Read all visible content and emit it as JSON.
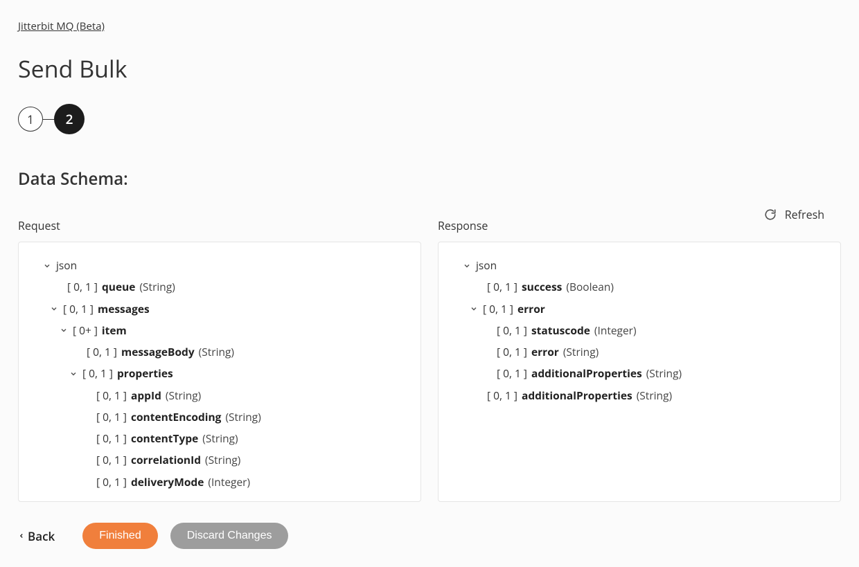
{
  "breadcrumb": "Jitterbit MQ (Beta)",
  "page_title": "Send Bulk",
  "stepper": {
    "s1": "1",
    "s2": "2"
  },
  "section_title": "Data Schema:",
  "refresh_label": "Refresh",
  "request_label": "Request",
  "response_label": "Response",
  "back_label": "Back",
  "finished_label": "Finished",
  "discard_label": "Discard Changes",
  "req": {
    "root": "json",
    "queue_card": "[ 0, 1 ]",
    "queue_name": "queue",
    "queue_type": "(String)",
    "messages_card": "[ 0, 1 ]",
    "messages_name": "messages",
    "item_card": "[ 0+ ]",
    "item_name": "item",
    "mbody_card": "[ 0, 1 ]",
    "mbody_name": "messageBody",
    "mbody_type": "(String)",
    "props_card": "[ 0, 1 ]",
    "props_name": "properties",
    "appId_card": "[ 0, 1 ]",
    "appId_name": "appId",
    "appId_type": "(String)",
    "cenc_card": "[ 0, 1 ]",
    "cenc_name": "contentEncoding",
    "cenc_type": "(String)",
    "ctype_card": "[ 0, 1 ]",
    "ctype_name": "contentType",
    "ctype_type": "(String)",
    "corr_card": "[ 0, 1 ]",
    "corr_name": "correlationId",
    "corr_type": "(String)",
    "dmode_card": "[ 0, 1 ]",
    "dmode_name": "deliveryMode",
    "dmode_type": "(Integer)"
  },
  "res": {
    "root": "json",
    "succ_card": "[ 0, 1 ]",
    "succ_name": "success",
    "succ_type": "(Boolean)",
    "err_card": "[ 0, 1 ]",
    "err_name": "error",
    "sc_card": "[ 0, 1 ]",
    "sc_name": "statuscode",
    "sc_type": "(Integer)",
    "ierr_card": "[ 0, 1 ]",
    "ierr_name": "error",
    "ierr_type": "(String)",
    "iap_card": "[ 0, 1 ]",
    "iap_name": "additionalProperties",
    "iap_type": "(String)",
    "ap_card": "[ 0, 1 ]",
    "ap_name": "additionalProperties",
    "ap_type": "(String)"
  }
}
